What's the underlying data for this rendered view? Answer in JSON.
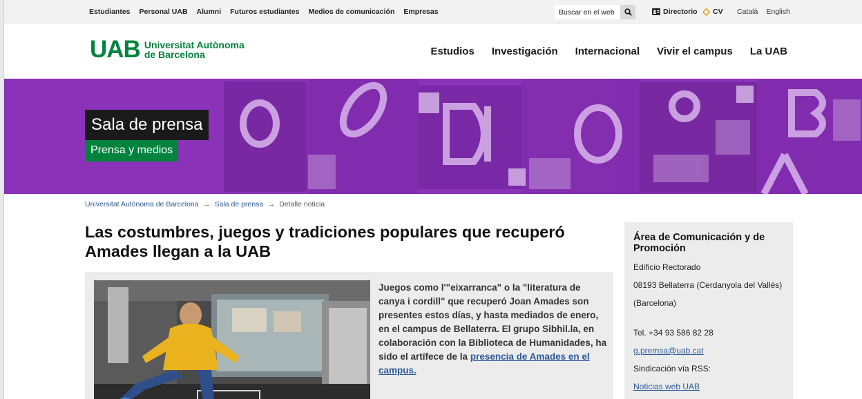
{
  "utility_bar": {
    "links": [
      "Estudiantes",
      "Personal UAB",
      "Alumni",
      "Futuros estudiantes",
      "Medios de comunicación",
      "Empresas"
    ],
    "search_placeholder": "Buscar en el web",
    "directory_label": "Directorio",
    "cv_label": "CV",
    "languages": [
      "Català",
      "English"
    ]
  },
  "header": {
    "logo_mark": "UAB",
    "logo_line1": "Universitat Autònoma",
    "logo_line2": "de Barcelona",
    "nav": [
      "Estudios",
      "Investigación",
      "Internacional",
      "Vivir el campus",
      "La UAB"
    ]
  },
  "banner": {
    "title": "Sala de prensa",
    "subtitle": "Prensa y medios"
  },
  "breadcrumb": {
    "items": [
      "Universitat Autònoma de Barcelona",
      "Sala de prensa",
      "Detalle noticia"
    ],
    "separator": "→"
  },
  "article": {
    "title": "Las costumbres, juegos y tradiciones populares que recuperó Amades llegan a la UAB",
    "lead_text": "Juegos como l'\"eixarranca\" o la \"literatura de canya i cordill\" que recuperó Joan Amades son presentes estos días, y hasta mediados de enero, en el campus de Bellaterra. El grupo Sibhil.la, en colaboración con la Biblioteca de Humanidades, ha sido el artífece de la",
    "lead_link": "presencia de Amades en el campus."
  },
  "sidebar": {
    "title": "Área de Comunicación y de Promoción",
    "address_1": "Edificio Rectorado",
    "address_2": "08193 Bellaterra (Cerdanyola del Vallès)",
    "address_3": "(Barcelona)",
    "phone": "Tel. +34 93 586 82 28",
    "email": "g.premsa@uab.cat",
    "rss_label": "Sindicación vía RSS:",
    "rss_link": "Noticias web UAB"
  },
  "colors": {
    "brand_green": "#00843d",
    "banner_purple": "#8a32b8",
    "link_blue": "#2a5a9a"
  }
}
